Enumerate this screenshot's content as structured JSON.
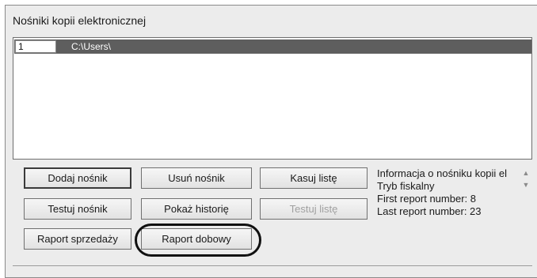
{
  "window": {
    "title": "Nośniki kopii elektronicznej"
  },
  "list": {
    "rows": [
      {
        "index": "1",
        "path": "C:\\Users\\"
      }
    ]
  },
  "buttons": {
    "add_media": "Dodaj nośnik",
    "remove_media": "Usuń nośnik",
    "clear_list": "Kasuj listę",
    "test_media": "Testuj nośnik",
    "show_history": "Pokaż historię",
    "test_list": "Testuj listę",
    "sales_report": "Raport sprzedaży",
    "daily_report": "Raport dobowy"
  },
  "info": {
    "lines": [
      "Informacja o nośniku kopii el",
      "Tryb fiskalny",
      "First report number: 8",
      "Last report number: 23"
    ]
  },
  "icons": {
    "scroll_up": "triangle-up-icon",
    "scroll_down": "triangle-down-icon"
  }
}
